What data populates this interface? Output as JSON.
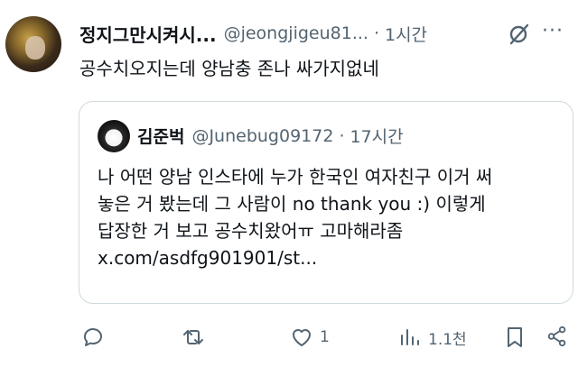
{
  "post": {
    "display_name": "정지그만시켜시...",
    "handle": "@jeongjigeu81...",
    "separator": "·",
    "time": "1시간",
    "more": "···",
    "text": "공수치오지는데 양남충 존나 싸가지없네"
  },
  "quote": {
    "display_name": "김준벅",
    "handle": "@Junebug09172",
    "separator": "·",
    "time": "17시간",
    "lines": [
      "나 어떤 양남 인스타에 누가 한국인 여자친구 이거 써",
      "놓은 거 봤는데 그 사람이 no thank you :) 이렇게",
      "답장한 거 보고 공수치왔어ㅠ 고마해라좀",
      "x.com/asdfg901901/st..."
    ]
  },
  "actions": {
    "reply_count": "",
    "repost_count": "",
    "like_count": "1",
    "views_count": "1.1천",
    "icons": [
      "reply-icon",
      "repost-icon",
      "like-icon",
      "views-icon",
      "bookmark-icon",
      "share-icon"
    ]
  }
}
